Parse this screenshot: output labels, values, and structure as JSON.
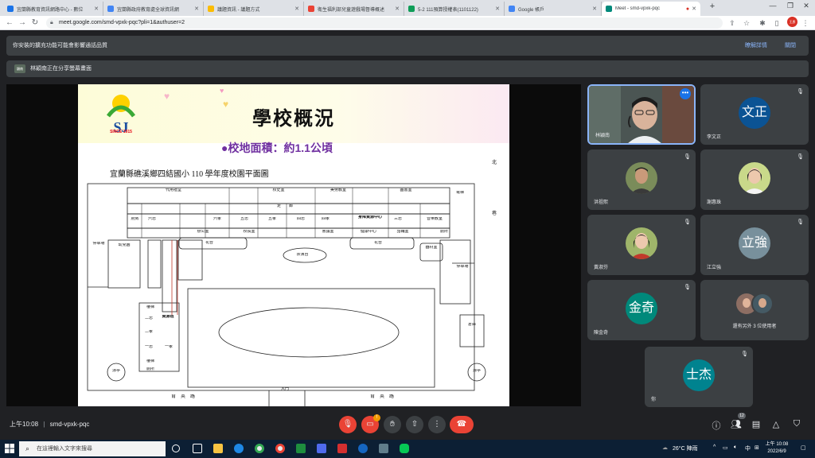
{
  "browser": {
    "tabs": [
      {
        "title": "宜蘭縣教育資訊網路中心 - 數位",
        "fav_color": "#1a73e8"
      },
      {
        "title": "宜蘭縣政府教育處全球資訊網",
        "fav_color": "#4285f4"
      },
      {
        "title": "議題資訊 - 議題方式",
        "fav_color": "#fbbc04"
      },
      {
        "title": "衛生福利部兒童遊戲場督導概述",
        "fav_color": "#ea4335"
      },
      {
        "title": "5-2 111預算授權表(1101122)",
        "fav_color": "#0f9d58"
      },
      {
        "title": "Google 帳戶",
        "fav_color": "#4285f4"
      },
      {
        "title": "Meet - smd-vpxk-pqc",
        "fav_color": "#00897b"
      }
    ],
    "new_tab": "+",
    "url": "meet.google.com/smd-vpxk-pqc?pli=1&authuser=2",
    "profile_initials": "王彥"
  },
  "banners": {
    "extension_warning": "你安裝的擴充功能可能會影響通話品質",
    "details_link": "瞭解詳情",
    "close_link": "關閉",
    "presenter_notice": "林穎南正在分享螢幕畫面",
    "presenter_thumb": "穎南"
  },
  "slide": {
    "title": "學校概況",
    "subtitle": "●校地面積：約1.1公頃",
    "logo_letters": "SJ",
    "logo_caption": "SINCE 1915",
    "plan_title": "宜蘭縣礁溪鄉四結國小 110 學年度校園平面圖",
    "labels": {
      "north": "北",
      "alley": "巷",
      "parking": "停車場",
      "avenue": "育英路",
      "gate": "大門",
      "stage": "表演台",
      "platform": "花台",
      "pavilion": "涼亭",
      "kitchen": "廚房",
      "stairs": "樓梯",
      "toilet": "廁所",
      "multipurpose": "代用禮堂",
      "computer": "電腦教室",
      "lab": "校史室",
      "art": "美勞教室",
      "library": "圖書室",
      "office": "辦公室",
      "principal": "校長室",
      "health": "健康中心",
      "counseling": "諮輔室",
      "music": "音樂教室",
      "meeting": "會議室",
      "disability": "身障資源中心",
      "elevator": "電梯",
      "six_loyalty": "六忠",
      "six_filial": "六孝",
      "five_loyalty": "五忠",
      "five_filial": "五孝",
      "four_loyalty": "四忠",
      "four_filial": "四孝",
      "three_loyalty": "三忠",
      "one_loyalty": "一忠",
      "one_filial": "一孝",
      "two_loyalty": "二忠",
      "two_filial": "二孝",
      "corridor": "走　　廊",
      "equipment": "器材室",
      "storage": "倉庫",
      "sports": "體育器材室",
      "special_ed": "資源班",
      "kinder": "幼兒園"
    }
  },
  "participants": [
    {
      "name": "林穎南",
      "type": "video"
    },
    {
      "name": "李文正",
      "initials": "文正",
      "color": "#0b5394"
    },
    {
      "name": "洪祖熙",
      "type": "photo"
    },
    {
      "name": "謝惠珠",
      "type": "photo"
    },
    {
      "name": "黃淑芬",
      "type": "photo"
    },
    {
      "name": "江立強",
      "initials": "立強",
      "color": "#78909c"
    },
    {
      "name": "陳金奇",
      "initials": "金奇",
      "color": "#00897b"
    },
    {
      "name": "還有另外 3 位使用者",
      "type": "group"
    },
    {
      "name": "你",
      "initials": "士杰",
      "color": "#00838f"
    }
  ],
  "meeting": {
    "time": "上午10:08",
    "code": "smd-vpxk-pqc",
    "people_count": "12",
    "chat_badge": "!"
  },
  "taskbar": {
    "search_placeholder": "在這裡輸入文字來搜尋",
    "weather": "26°C 陣雨",
    "ime": "中",
    "clock_time": "上午 10:08",
    "clock_date": "2022/6/9"
  }
}
